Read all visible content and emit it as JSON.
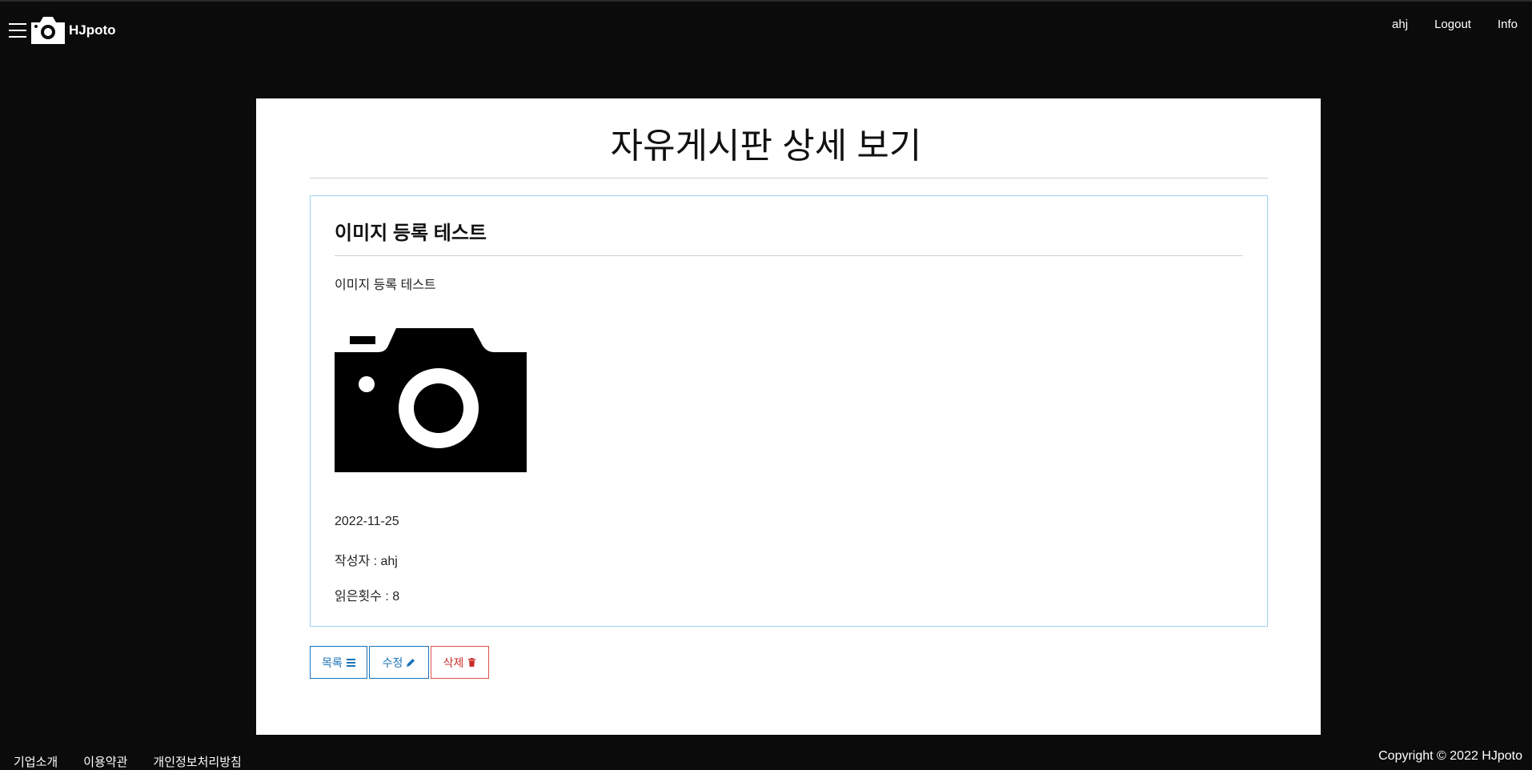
{
  "header": {
    "brand": "HJpoto",
    "nav": [
      "ahj",
      "Logout",
      "Info"
    ]
  },
  "page": {
    "title": "자유게시판 상세 보기"
  },
  "post": {
    "title": "이미지 등록 테스트",
    "body": "이미지 등록 테스트",
    "image_icon": "camera-icon",
    "date": "2022-11-25",
    "author": "작성자 : ahj",
    "views": "읽은횟수 : 8"
  },
  "actions": {
    "list_label": "목록",
    "edit_label": "수정",
    "delete_label": "삭제"
  },
  "footer": {
    "links": [
      "기업소개",
      "이용약관",
      "개인정보처리방침"
    ],
    "copyright": "Copyright © 2022 HJpoto"
  },
  "colors": {
    "background": "#0b0b0b",
    "card": "#ffffff",
    "post_border": "#9fd1ee",
    "primary": "#1a73b8",
    "danger": "#c9302c"
  }
}
